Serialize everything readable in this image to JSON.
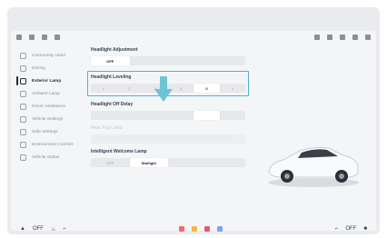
{
  "sidebar": {
    "items": [
      {
        "label": "Community Used",
        "icon": "community-icon"
      },
      {
        "label": "Driving",
        "icon": "steering-icon"
      },
      {
        "label": "Exterior Lamp",
        "icon": "lamp-icon",
        "active": true
      },
      {
        "label": "Ambient Lamp",
        "icon": "ambient-icon"
      },
      {
        "label": "Driver Assistance",
        "icon": "assist-icon"
      },
      {
        "label": "Vehicle Settings",
        "icon": "car-icon"
      },
      {
        "label": "Safe Settings",
        "icon": "shield-icon"
      },
      {
        "label": "Environment Comfort",
        "icon": "fan-icon"
      },
      {
        "label": "Vehicle Status",
        "icon": "status-icon"
      }
    ]
  },
  "headlight_adjustment": {
    "title": "Headlight Adjustment",
    "options": [
      "OFF",
      "",
      "",
      ""
    ],
    "selected_index": 0
  },
  "headlight_leveling": {
    "title": "Headlight Leveling",
    "options": [
      "",
      "2",
      "3",
      "4",
      "0",
      ""
    ],
    "selected_index": 4
  },
  "headlight_off_delay": {
    "title": "Headlight Off Delay",
    "options": [
      "",
      "",
      "",
      "",
      "",
      ""
    ],
    "selected_index": 4
  },
  "rear_fog_lamp": {
    "title": "Rear Fog Lamp",
    "options": [
      "",
      ""
    ]
  },
  "welcome_lamp": {
    "title": "Intelligent Welcome Lamp",
    "options": [
      "OFF",
      "Starlight",
      "",
      ""
    ],
    "selected_index": 1
  },
  "dock": {
    "left_label": "OFF",
    "right_label": "OFF"
  },
  "colors": {
    "accent": "#4fb3c8",
    "arrow": "#6cc4d6"
  }
}
